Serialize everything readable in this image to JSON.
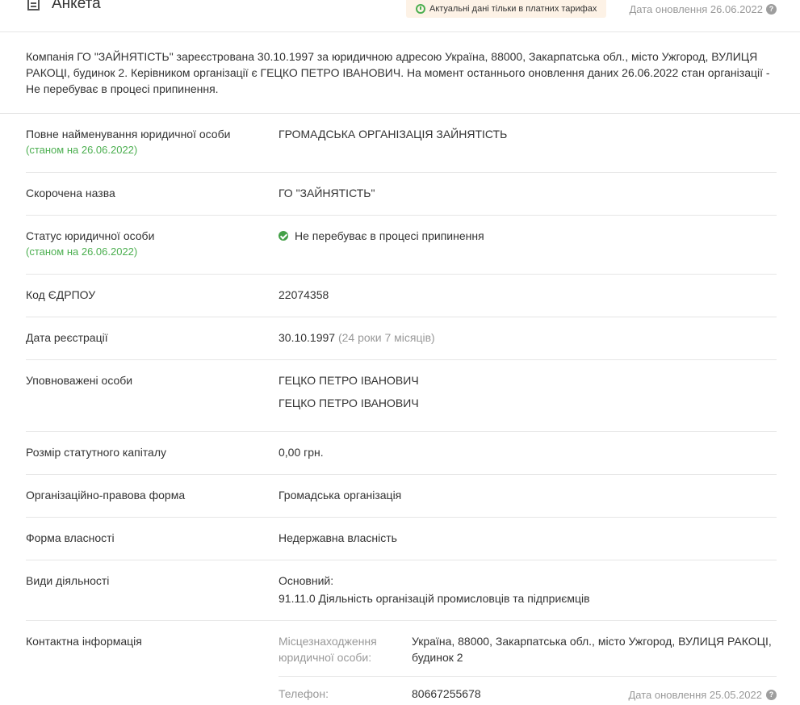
{
  "header": {
    "title": "Анкета",
    "paid_badge": "Актуальні дані тільки в платних тарифах",
    "update_date": "Дата оновлення 26.06.2022",
    "help": "?"
  },
  "summary": "Компанія ГО \"ЗАЙНЯТІСТЬ\" зареєстрована 30.10.1997 за юридичною адресою Україна, 88000, Закарпатська обл., місто Ужгород, ВУЛИЦЯ РАКОЦІ, будинок 2. Керівником організації є ГЕЦКО ПЕТРО ІВАНОВИЧ. На момент останнього оновлення даних 26.06.2022 стан організації - Не перебуває в процесі припинення.",
  "rows": {
    "full_name": {
      "label": "Повне найменування юридичної особи",
      "sub": "(станом на 26.06.2022)",
      "value": "ГРОМАДСЬКА ОРГАНІЗАЦІЯ ЗАЙНЯТІСТЬ"
    },
    "short_name": {
      "label": "Скорочена назва",
      "value": "ГО \"ЗАЙНЯТІСТЬ\""
    },
    "status": {
      "label": "Статус юридичної особи",
      "sub": "(станом на 26.06.2022)",
      "value": "Не перебуває в процесі припинення"
    },
    "edrpou": {
      "label": "Код ЄДРПОУ",
      "value": "22074358"
    },
    "reg_date": {
      "label": "Дата реєстрації",
      "value": "30.10.1997",
      "age": "(24 роки 7 місяців)"
    },
    "authorized": {
      "label": "Уповноважені особи",
      "persons": [
        "ГЕЦКО ПЕТРО ІВАНОВИЧ",
        "ГЕЦКО ПЕТРО ІВАНОВИЧ"
      ]
    },
    "capital": {
      "label": "Розмір статутного капіталу",
      "value": "0,00 грн."
    },
    "legal_form": {
      "label": "Організаційно-правова форма",
      "value": "Громадська організація"
    },
    "ownership": {
      "label": "Форма власності",
      "value": "Недержавна власність"
    },
    "activities": {
      "label": "Види діяльності",
      "main_label": "Основний:",
      "main_value": "91.11.0 Діяльність організацій промисловців та підприємців"
    },
    "contacts": {
      "label": "Контактна інформація",
      "address_key": "Місцезнаходження юридичної особи:",
      "address_value": "Україна, 88000, Закарпатська обл., місто Ужгород, ВУЛИЦЯ РАКОЦІ, будинок 2",
      "phone_key": "Телефон:",
      "phone_value": "80667255678",
      "phone_date": "Дата оновлення 25.05.2022"
    }
  }
}
